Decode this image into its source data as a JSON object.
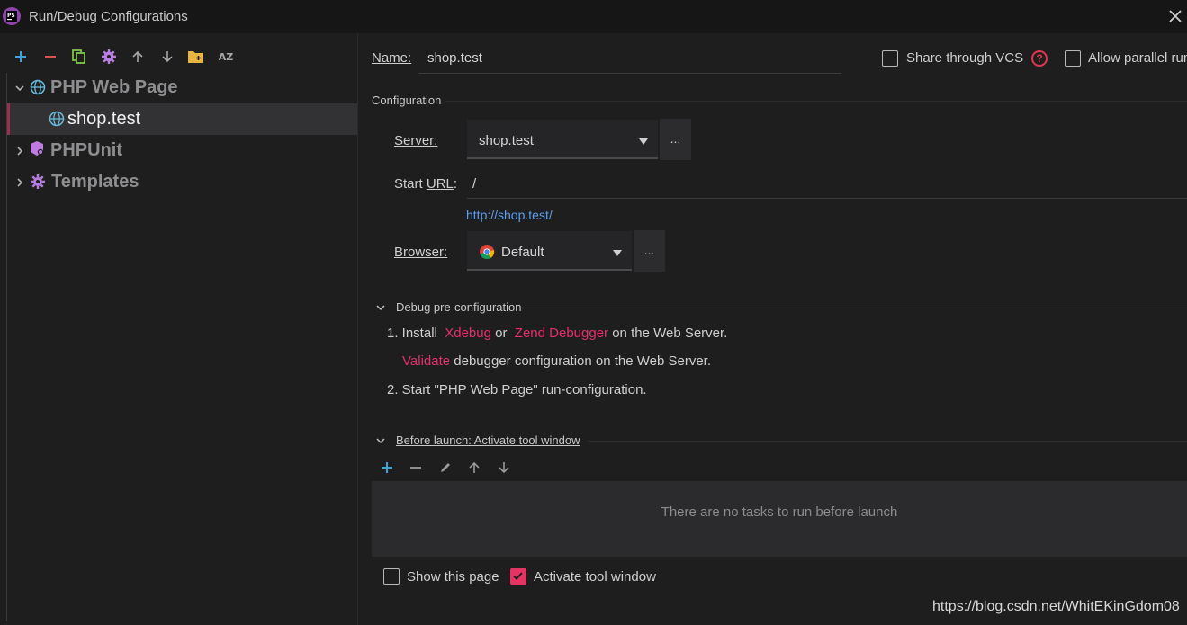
{
  "window": {
    "title": "Run/Debug Configurations",
    "app_icon_text": "PS"
  },
  "left_toolbar": {
    "icons": [
      "add-icon",
      "remove-icon",
      "copy-icon",
      "settings-icon",
      "move-up-icon",
      "move-down-icon",
      "new-folder-icon",
      "sort-az-icon"
    ],
    "sort_icon_text": "AZ"
  },
  "tree": {
    "items": [
      {
        "label": "PHP Web Page",
        "icon": "globe-icon",
        "expanded": true
      },
      {
        "label": "shop.test",
        "icon": "globe-icon",
        "selected": true
      },
      {
        "label": "PHPUnit",
        "icon": "phpunit-icon",
        "expanded": false
      },
      {
        "label": "Templates",
        "icon": "gear-icon",
        "expanded": false
      }
    ]
  },
  "header": {
    "name_label": "Name:",
    "name_value": "shop.test",
    "share_vcs_label": "Share through VCS",
    "allow_parallel_label": "Allow parallel run"
  },
  "configuration": {
    "section_title": "Configuration",
    "server_label": "Server:",
    "server_value": "shop.test",
    "server_more": "...",
    "start_url_label": "Start URL:",
    "start_url_value": "/",
    "resolved_url": "http://shop.test/",
    "browser_label": "Browser:",
    "browser_value": "Default",
    "browser_more": "..."
  },
  "debug_preconfig": {
    "section_title": "Debug pre-configuration",
    "step1_prefix": "1. Install",
    "xdebug_link": "Xdebug",
    "or_text": "or",
    "zend_link": "Zend Debugger",
    "step1_suffix": "on the Web Server.",
    "validate_link": "Validate",
    "validate_suffix": "debugger configuration on the Web Server.",
    "step2": "2. Start \"PHP Web Page\" run-configuration."
  },
  "before_launch": {
    "section_title": "Before launch: Activate tool window",
    "icons": [
      "add-icon",
      "remove-icon",
      "edit-icon",
      "move-up-icon",
      "move-down-icon"
    ],
    "empty_text": "There are no tasks to run before launch",
    "show_page_label": "Show this page",
    "show_page_checked": false,
    "activate_tool_label": "Activate tool window",
    "activate_tool_checked": true
  },
  "watermark": "https://blog.csdn.net/WhitEKinGdom08",
  "colors": {
    "accent_pink": "#e53463",
    "link_blue": "#5c9ef0",
    "add_cyan": "#3fa5d8",
    "remove_red": "#d9534f",
    "copy_green": "#7fc64b",
    "settings_purple": "#b77ee0",
    "folder_yellow": "#e8b640"
  }
}
